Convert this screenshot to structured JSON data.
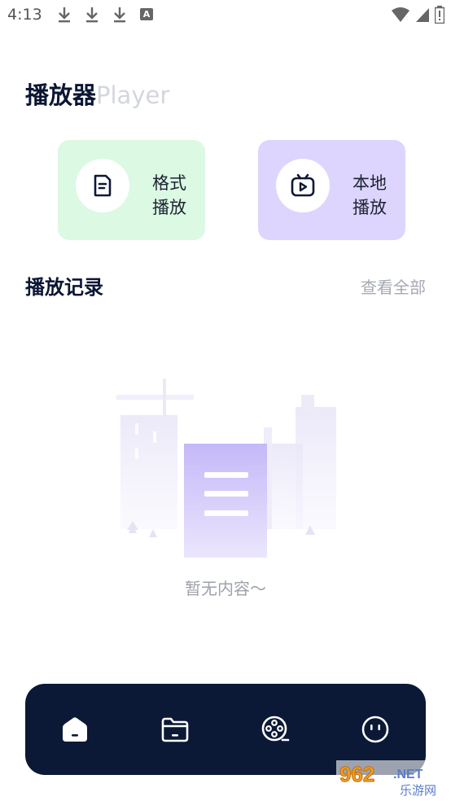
{
  "status_bar": {
    "time": "4:13",
    "icons": [
      "download-icon",
      "download-icon",
      "download-icon",
      "a-icon",
      "wifi-icon",
      "signal-icon",
      "battery-icon"
    ],
    "a_glyph": "A"
  },
  "header": {
    "title": "播放器",
    "title_en": "Player"
  },
  "cards": [
    {
      "label_line1": "格式",
      "label_line2": "播放",
      "icon": "document-icon",
      "bg": "#dcf9e3"
    },
    {
      "label_line1": "本地",
      "label_line2": "播放",
      "icon": "tv-play-icon",
      "bg": "#ddd5fd"
    }
  ],
  "history": {
    "title": "播放记录",
    "see_all": "查看全部",
    "empty_text": "暂无内容～"
  },
  "bottom_nav": {
    "items": [
      "home-icon",
      "folder-icon",
      "film-reel-icon",
      "profile-face-icon"
    ],
    "bg": "#0b1936"
  },
  "watermark": {
    "brand": "962",
    "suffix": ".NET",
    "subtitle": "乐游网"
  }
}
